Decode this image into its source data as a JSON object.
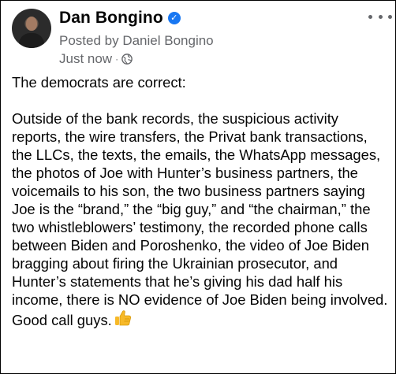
{
  "post": {
    "author_name": "Dan Bongino",
    "posted_by": "Posted by Daniel Bongino",
    "timestamp": "Just now",
    "separator": "·",
    "verified_icon": "verified-badge-icon",
    "audience_icon": "globe-icon",
    "more_icon": "more-options-icon",
    "lead": "The democrats are correct:",
    "body": "Outside of the bank records, the suspicious activity reports, the wire transfers, the Privat bank transactions, the LLCs, the texts, the emails, the WhatsApp messages, the photos of Joe with Hunter’s business partners, the voicemails to his son, the two business partners saying Joe is the “brand,” the “big guy,” and “the chairman,” the two whistleblowers’ testimony, the recorded phone calls between Biden and Poroshenko, the video of Joe Biden bragging about firing the Ukrainian prosecutor, and Hunter’s statements that he’s giving his dad half his income, there is NO evidence of Joe Biden being involved.",
    "closing": "Good call guys.",
    "closing_emoji": "thumbs-up-icon"
  },
  "colors": {
    "accent": "#1877f2",
    "secondary_text": "#65676b",
    "primary_text": "#050505",
    "emoji": "#f7b928"
  }
}
